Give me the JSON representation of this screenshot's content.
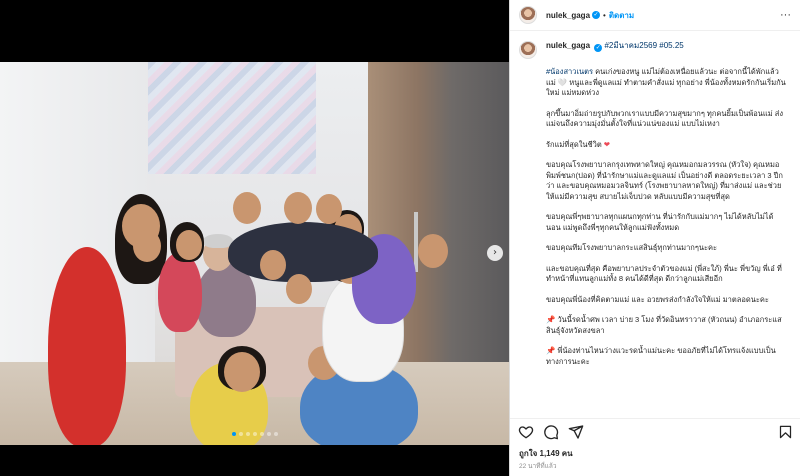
{
  "header": {
    "username": "nulek_gaga",
    "follow_label": "ติดตาม",
    "more_label": "···"
  },
  "caption": {
    "username": "nulek_gaga",
    "date_tag": "#2มีนาคม2569",
    "number_tag": "#05.25",
    "paragraphs": [
      {
        "tag": "#น้องสาวเนตร",
        "text": " คนเก่งของหนู แม่ไม่ต้องเหนื่อยแล้วนะ ต่อจากนี้ได้พักแล้วแม่ 🤍 หนูและพี่ดูแลแม่ ทำตามคำสั่งแม่ ทุกอย่าง พี่น้องทั้งหมดรักกันเริ่มกันใหม่ แม่หมดห่วง"
      },
      {
        "tag": "",
        "text": "ลุกขึ้นมาอิ่มถ่ายรูปกับพวกเราแบบมีความสุขมากๆ ทุกคนยิ้มเป็นพ้อนแม่ ส่งแม่จนถึงความมุ่งมั่นตั้งใจที่แน่วแน่ของแม่ แบบไม่เหงา"
      },
      {
        "tag": "",
        "text": "รักแม่ที่สุดในชีวิต",
        "heart": "❤"
      },
      {
        "tag": "",
        "text": "ขอบคุณโรงพยาบาลกรุงเทพหาดใหญ่ คุณหมอกมลวรรณ (หัวใจ) คุณหมอพิมพ์ชนก(ปอด) ที่นำรักษาแม่และดูแลแม่ เป็นอย่างดี ตลอดระยะเวลา 3 ปีกว่า และขอบคุณหมอมวลจินทร์ (โรงพยาบาลหาดใหญ่) ที่มาส่งแม่ และช่วยให้แม่มีความสุข สบายไม่เจ็บปวด หลับแบบมีความสุขที่สุด"
      },
      {
        "tag": "",
        "text": "ขอบคุณพี่ๆพยาบาลทุกแผนกทุกท่าน ที่น่ารักกับแม่มากๆ ไม่ได้หลับไม่ได้นอน แม่พูดถึงพี่ๆทุกคนให้ลูกแม่ฟังทั้งหมด"
      },
      {
        "tag": "",
        "text": "ขอบคุณทีมโรงพยาบาลกระแสสินธุ์ทุกท่านมากๆนะคะ"
      },
      {
        "tag": "",
        "text": "และขอบคุณที่สุด คือพยาบาลประจำตัวของแม่ (พี่สะใภ้) พี่นะ พี่ขวัญ พี่เอ๋ ที่ทำหน้าที่แทนลูกแม่ทั้ง 8 คนได้ดีที่สุด ดีกว่าลูกแม่เสียอีก"
      },
      {
        "tag": "",
        "text": "ขอบคุณพี่น้องที่คิดตามแม่ และ อวยพรส่งกำลังใจให้แม่ มาตลอดนะคะ"
      },
      {
        "tag": "",
        "text": "วันนี้รดน้ำศพ เวลา บ่าย 3 โมง ที่วัดอินทราวาส (หัวถนน) อำเภอกระแสสินธุ์จังหวัดสงขลา",
        "pin": "📌"
      },
      {
        "tag": "",
        "text": "พี่น้องท่านไหนว่างแวะรดน้ำแม่นะคะ ขออภัยที่ไม่ได้โทรแจ้งแบบเป็นทางการนะคะ",
        "pin": "📌"
      }
    ]
  },
  "likes_label": "ถูกใจ 1,149 คน",
  "time_label": "22 นาทีที่แล้ว",
  "carousel": {
    "count": 7,
    "active": 0
  },
  "colors": {
    "accent": "#0095f6",
    "heart": "#ed4956",
    "hashtag": "#00376b"
  },
  "icons": {
    "like": "heart-outline-icon",
    "comment": "comment-icon",
    "share": "paper-plane-icon",
    "save": "bookmark-icon",
    "next": "chevron-right-icon"
  }
}
